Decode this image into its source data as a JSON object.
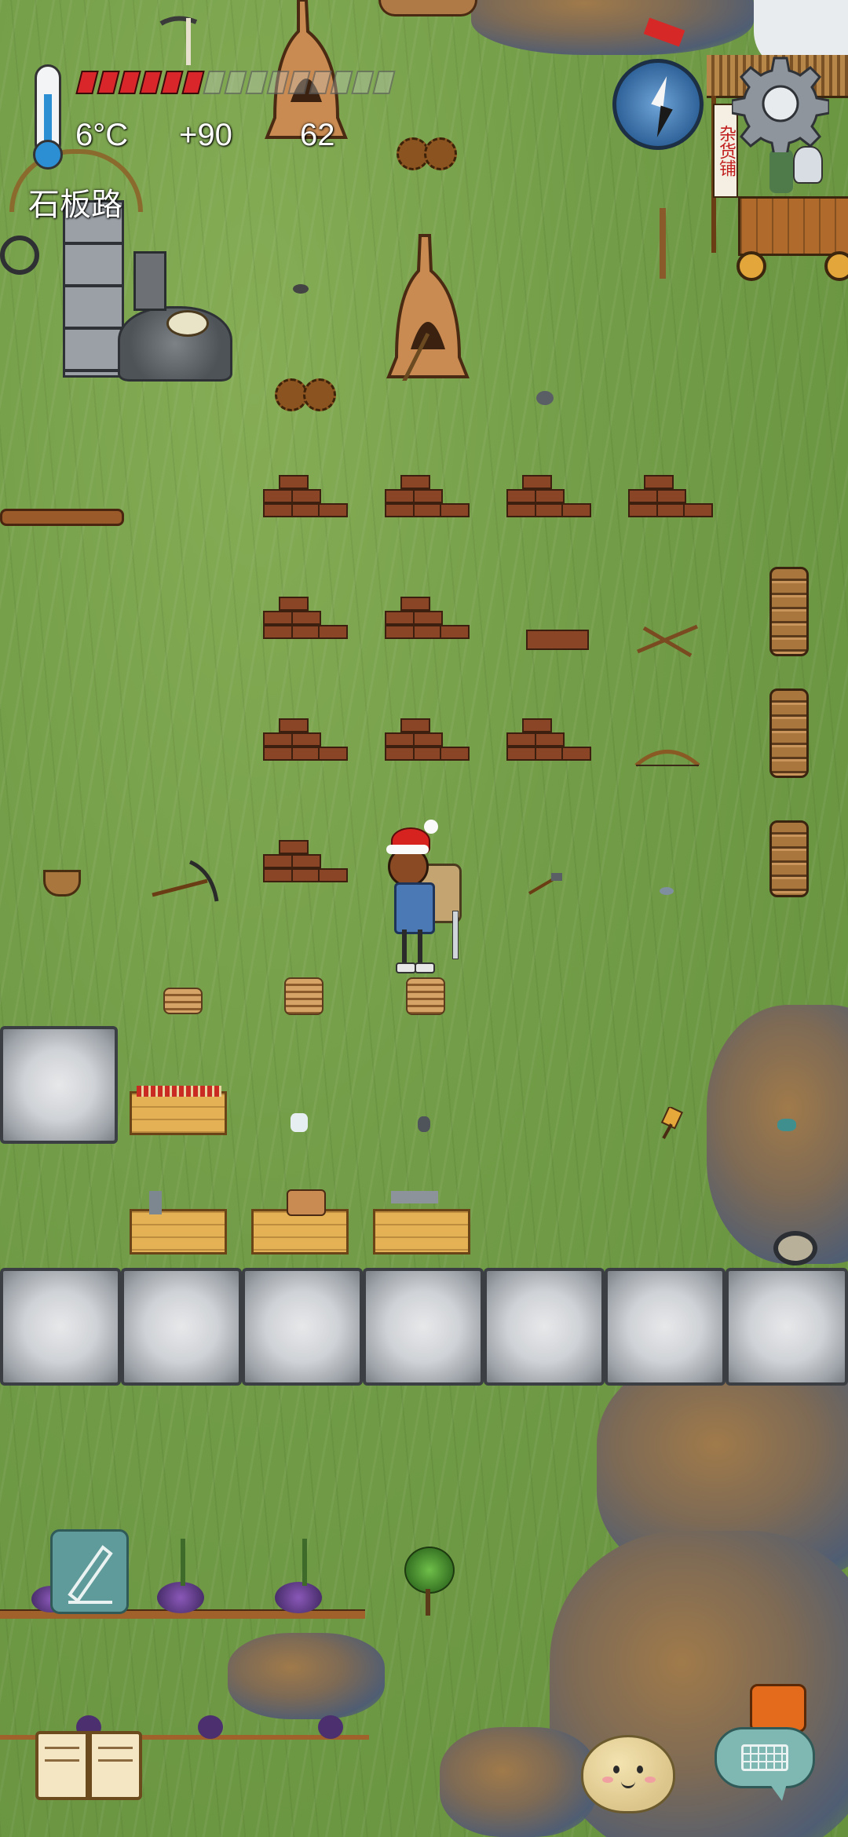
{
  "hud": {
    "temperature": "6°C",
    "food_bonus": "+90",
    "age": "62",
    "health_segments_total": 15,
    "health_segments_filled": 6,
    "location": "石板路"
  },
  "shop": {
    "sign": "杂货铺"
  },
  "icons": {
    "thermometer": "thermometer-icon",
    "compass": "compass-icon",
    "settings": "gear-icon",
    "note": "pencil-note-icon",
    "recipe_book": "book-icon",
    "emote": "potato-face-icon",
    "chat": "keyboard-chat-icon"
  },
  "colors": {
    "grass": "#739d48",
    "health_red": "#d8262b",
    "hud_text": "#ffffff",
    "note_button": "#5f9b9a",
    "chat_bubble": "#7fb8b3"
  }
}
